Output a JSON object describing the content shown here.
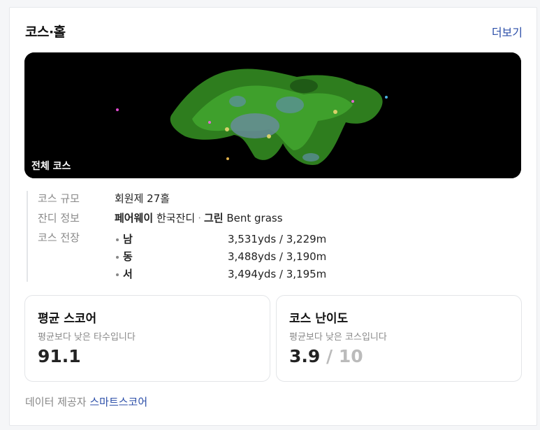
{
  "header": {
    "title": "코스·홀",
    "more_label": "더보기"
  },
  "map": {
    "label": "전체 코스"
  },
  "info": {
    "scale_key": "코스 규모",
    "scale_value": "회원제 27홀",
    "turf_key": "잔디 정보",
    "fairway_label": "페어웨이",
    "fairway_value": "한국잔디",
    "separator": "·",
    "green_label": "그린",
    "green_value": "Bent grass",
    "length_key": "코스 전장",
    "lengths": [
      {
        "name": "남",
        "value": "3,531yds / 3,229m"
      },
      {
        "name": "동",
        "value": "3,488yds / 3,190m"
      },
      {
        "name": "서",
        "value": "3,494yds / 3,195m"
      }
    ]
  },
  "stats": {
    "avg_score": {
      "title": "평균 스코어",
      "sub": "평균보다 낮은 타수입니다",
      "value": "91.1"
    },
    "difficulty": {
      "title": "코스 난이도",
      "sub": "평균보다 낮은 코스입니다",
      "value": "3.9",
      "max": "/ 10"
    }
  },
  "footer": {
    "provider_label": "데이터 제공자",
    "provider_name": "스마트스코어"
  }
}
